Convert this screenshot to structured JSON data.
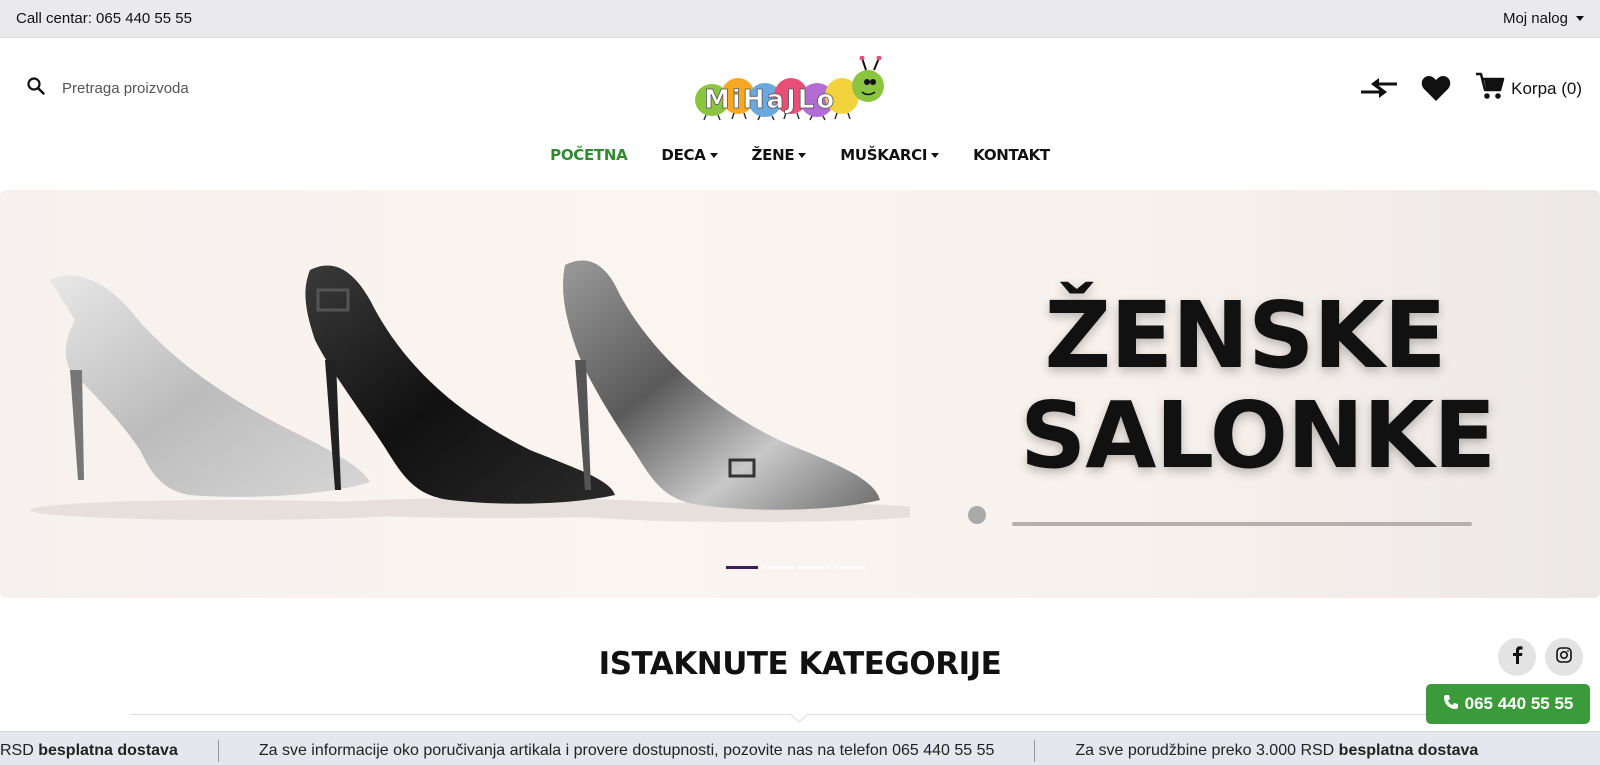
{
  "topbar": {
    "call_center": "Call centar: 065 440 55 55",
    "account_label": "Moj nalog"
  },
  "search": {
    "placeholder": "Pretraga proizvoda"
  },
  "logo": {
    "text": "MiHaJLo"
  },
  "header": {
    "compare_icon": "compare-arrows-icon",
    "wishlist_icon": "heart-icon",
    "cart_icon": "cart-icon",
    "cart_label": "Korpa (0)"
  },
  "nav": {
    "items": [
      {
        "label": "POČETNA",
        "active": true
      },
      {
        "label": "DECA",
        "dropdown": true
      },
      {
        "label": "ŽENE",
        "dropdown": true
      },
      {
        "label": "MUŠKARCI",
        "dropdown": true
      },
      {
        "label": "KONTAKT"
      }
    ]
  },
  "hero": {
    "line1": "ŽENSKE",
    "line2": "SALONKE",
    "slides_count": 5,
    "active_slide": 1
  },
  "featured": {
    "title": "ISTAKNUTE KATEGORIJE"
  },
  "social": {
    "facebook_icon": "facebook-icon",
    "instagram_icon": "instagram-icon"
  },
  "phone_button": {
    "label": "065 440 55 55"
  },
  "ticker": {
    "item1_plain": "RSD ",
    "item1_bold": "besplatna dostava",
    "item2": "Za sve informacije oko poručivanja artikala i provere dostupnosti, pozovite nas na telefon 065 440 55 55",
    "item3_plain": "Za sve porudžbine preko 3.000 RSD ",
    "item3_bold": "besplatna dostava"
  },
  "colors": {
    "accent_green": "#2e8b2e",
    "button_green": "#3b9b3b",
    "topbar_bg": "#eaeaec",
    "ticker_bg": "#e4e7ee"
  }
}
